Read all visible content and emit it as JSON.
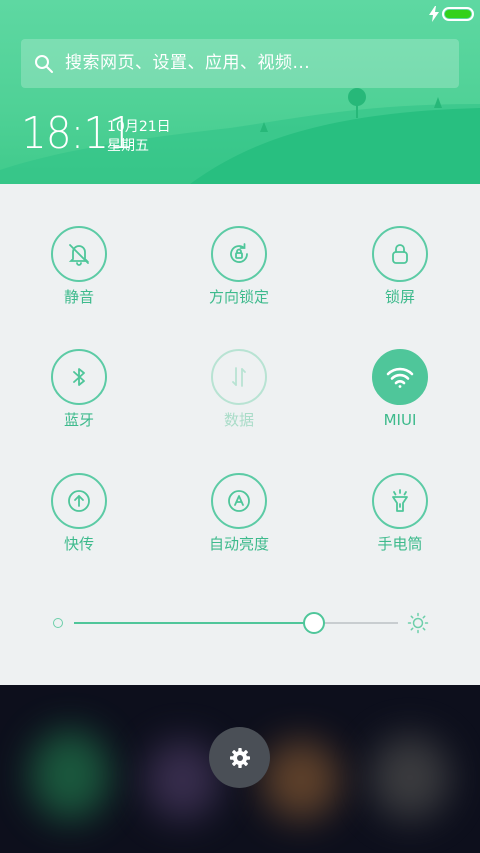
{
  "colors": {
    "accent": "#4fc69a",
    "header_green": "#4fd196",
    "panel_bg": "#eef1f2"
  },
  "status_bar": {
    "icons": [
      "charging-bolt-icon",
      "battery-icon"
    ]
  },
  "search": {
    "placeholder": "搜索网页、设置、应用、视频..."
  },
  "clock": {
    "time": "18:11",
    "date": "10月21日",
    "weekday": "星期五"
  },
  "toggles": [
    {
      "label": "静音",
      "icon": "bell-off-icon",
      "state": "off"
    },
    {
      "label": "方向锁定",
      "icon": "rotation-lock-icon",
      "state": "off"
    },
    {
      "label": "锁屏",
      "icon": "lock-icon",
      "state": "off"
    },
    {
      "label": "蓝牙",
      "icon": "bluetooth-icon",
      "state": "off"
    },
    {
      "label": "数据",
      "icon": "mobile-data-icon",
      "state": "disabled"
    },
    {
      "label": "MIUI",
      "icon": "wifi-icon",
      "state": "on"
    },
    {
      "label": "快传",
      "icon": "transfer-icon",
      "state": "off"
    },
    {
      "label": "自动亮度",
      "icon": "auto-brightness-icon",
      "state": "off"
    },
    {
      "label": "手电筒",
      "icon": "flashlight-icon",
      "state": "off"
    }
  ],
  "brightness": {
    "level": 0.74
  },
  "dock": {
    "settings_icon": "gear-icon"
  }
}
